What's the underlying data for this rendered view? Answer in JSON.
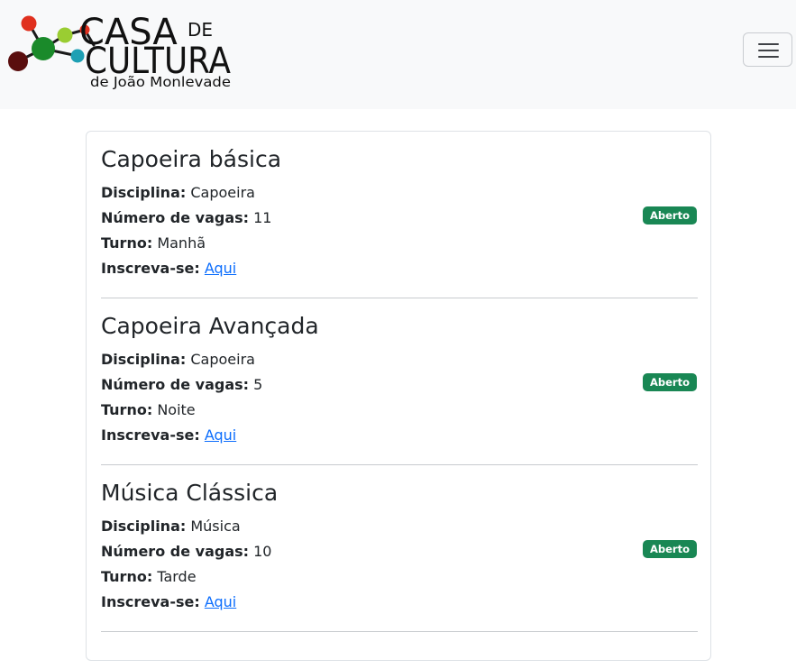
{
  "brand": {
    "line1_a": "CASA",
    "line1_b": "DE",
    "line2": "CULTURA",
    "line3": "de João Monlevade",
    "logo_colors": [
      "#e0301e",
      "#1a8a2a",
      "#9acd32",
      "#1ea0b4",
      "#5a0e0e"
    ]
  },
  "navbar": {
    "toggler_icon": "hamburger-icon"
  },
  "labels": {
    "discipline": "Disciplina:",
    "slots": "Número de vagas:",
    "shift": "Turno:",
    "signup": "Inscreva-se:"
  },
  "courses": [
    {
      "title": "Capoeira básica",
      "discipline": "Capoeira",
      "slots": "11",
      "shift": "Manhã",
      "link": "Aqui",
      "status": "Aberto"
    },
    {
      "title": "Capoeira Avançada",
      "discipline": "Capoeira",
      "slots": "5",
      "shift": "Noite",
      "link": "Aqui",
      "status": "Aberto"
    },
    {
      "title": "Música Clássica",
      "discipline": "Música",
      "slots": "10",
      "shift": "Tarde",
      "link": "Aqui",
      "status": "Aberto"
    }
  ],
  "colors": {
    "badge": "#198754",
    "link": "#0d6efd",
    "navbar_bg": "#f8f9fa"
  }
}
